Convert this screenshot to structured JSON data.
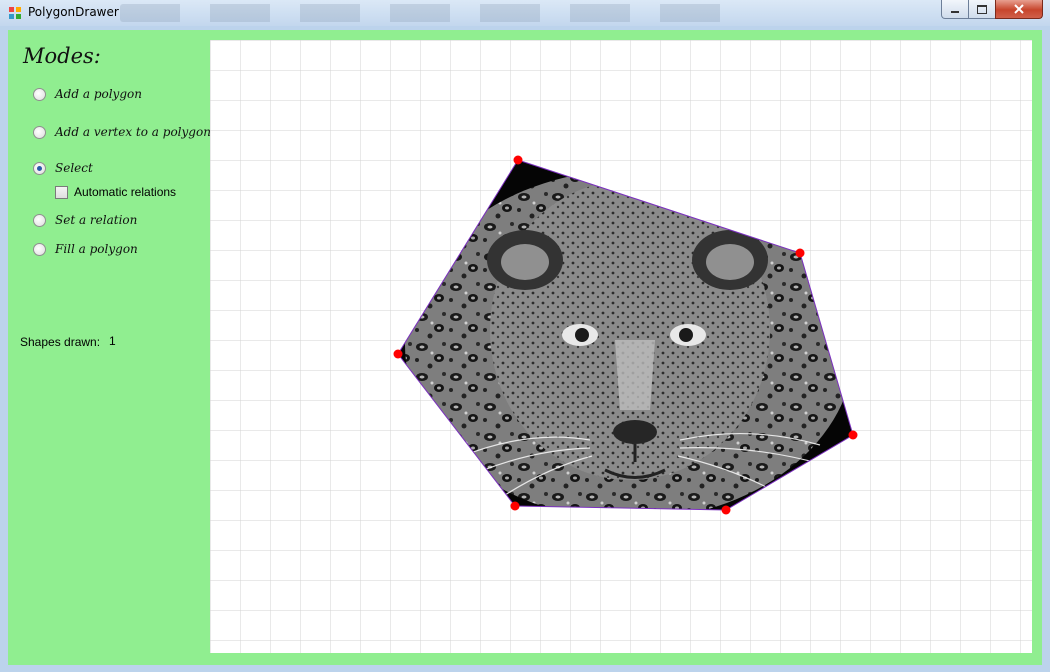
{
  "window": {
    "title": "PolygonDrawer",
    "icons": {
      "app": "app-icon",
      "minimize": "minimize-icon",
      "maximize": "maximize-icon",
      "close": "close-icon"
    }
  },
  "sidebar": {
    "heading": "Modes:",
    "modes": [
      {
        "label": "Add a polygon",
        "checked": false
      },
      {
        "label": "Add a vertex to a polygon",
        "checked": false
      },
      {
        "label": "Select",
        "checked": true
      },
      {
        "label": "Set a relation",
        "checked": false
      },
      {
        "label": "Fill a polygon",
        "checked": false
      }
    ],
    "automatic_relations": {
      "label": "Automatic relations",
      "checked": false
    },
    "shapes_drawn": {
      "label": "Shapes drawn:",
      "value": "1"
    }
  },
  "canvas": {
    "polygon_fill": "jaguar-photo",
    "colors": {
      "vertex": "#ff0000",
      "edge": "#7b2fbf",
      "grid": "#d3d3d3",
      "sidebar": "#90ee90"
    }
  }
}
